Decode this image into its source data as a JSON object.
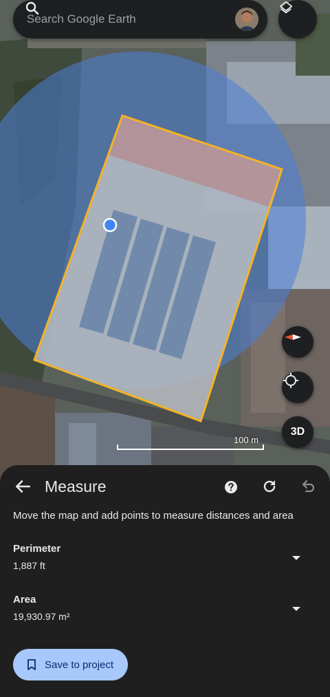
{
  "search": {
    "placeholder": "Search Google Earth",
    "icon": "search-icon"
  },
  "map": {
    "scale_label": "100 m",
    "buttons": {
      "three_d_label": "3D"
    },
    "colors": {
      "measure_outline": "#f5b324",
      "accuracy_circle": "#4a7fd8",
      "location_dot": "#4285f4"
    }
  },
  "measure": {
    "title": "Measure",
    "instructions": "Move the map and add points to measure distances and area",
    "perimeter": {
      "label": "Perimeter",
      "value": "1,887 ft"
    },
    "area": {
      "label": "Area",
      "value": "19,930.97 m²"
    },
    "save_label": "Save to project"
  },
  "colors": {
    "sheet_bg": "#1f1f1f",
    "save_button_bg": "#a8c7fa",
    "save_button_text": "#062e6f"
  }
}
